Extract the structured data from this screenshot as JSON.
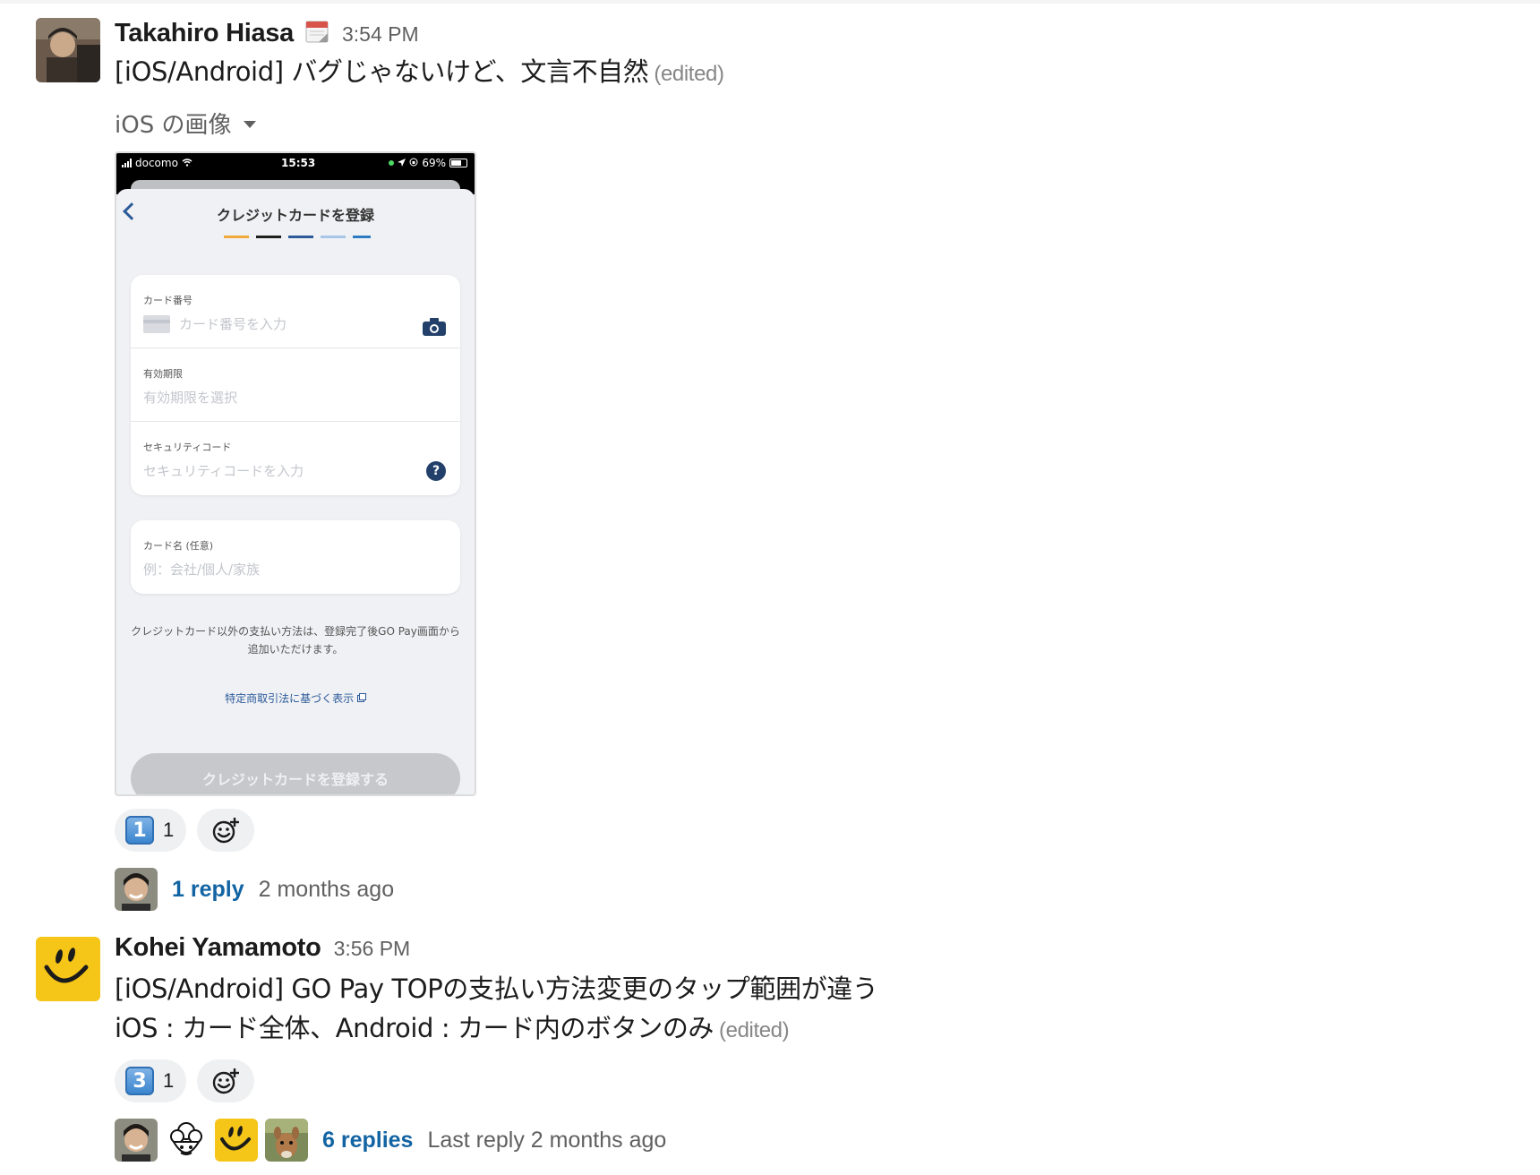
{
  "messages": [
    {
      "author": "Takahiro Hiasa",
      "status_emoji": "calendar-icon",
      "time": "3:54 PM",
      "text": "[iOS/Android] バグじゃないけど、文言不自然",
      "edited": "(edited)",
      "file_label": "iOS の画像",
      "reactions": [
        {
          "emoji": "keycap-1",
          "glyph": "1",
          "count": "1"
        }
      ],
      "thread": {
        "replies": "1 reply",
        "last": "2 months ago"
      }
    },
    {
      "author": "Kohei Yamamoto",
      "time": "3:56 PM",
      "lines": [
        "[iOS/Android] GO Pay TOPの支払い方法変更のタップ範囲が違う",
        "iOS : カード全体、Android : カード内のボタンのみ"
      ],
      "edited": "(edited)",
      "reactions": [
        {
          "emoji": "keycap-3",
          "glyph": "3",
          "count": "1"
        }
      ],
      "thread": {
        "replies": "6 replies",
        "last": "Last reply 2 months ago"
      }
    }
  ],
  "phone": {
    "carrier": "docomo",
    "clock": "15:53",
    "battery": "69%",
    "title": "クレジットカードを登録",
    "fields": [
      {
        "label": "カード番号",
        "placeholder": "カード番号を入力"
      },
      {
        "label": "有効期限",
        "placeholder": "有効期限を選択"
      },
      {
        "label": "セキュリティコード",
        "placeholder": "セキュリティコードを入力"
      }
    ],
    "name_field": {
      "label": "カード名 (任意)",
      "placeholder": "例：会社/個人/家族"
    },
    "note": "クレジットカード以外の支払い方法は、登録完了後GO Pay画面から追加いただけます。",
    "legal_link": "特定商取引法に基づく表示",
    "submit": "クレジットカードを登録する"
  },
  "colors": {
    "link": "#1264a3",
    "muted": "#616061",
    "reaction_bg": "#eff0f1",
    "brand_navy": "#23406b"
  }
}
